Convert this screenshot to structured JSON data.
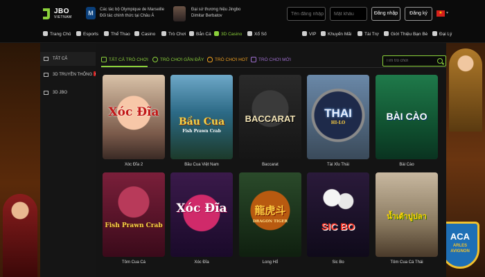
{
  "header": {
    "logo_text": "JBO",
    "logo_sub": "VIETNAM",
    "partner_line1": "Các tác bộ Olympique de Marseille",
    "partner_line2": "Đối tác chính thức tại Châu Á",
    "ambassador_line1": "Đại sứ thương hiệu Jingbo",
    "ambassador_line2": "Dimitar Berbatov",
    "username_placeholder": "Tên đăng nhập",
    "password_placeholder": "Mật khẩu",
    "login_label": "Đăng nhập",
    "register_label": "Đăng ký",
    "flag_star": "★",
    "caret": "▾"
  },
  "nav": {
    "items": [
      "Trang Chủ",
      "Esports",
      "Thể Thao",
      "Casino",
      "Trò Chơi",
      "Bắn Cá",
      "3D Casino",
      "Xổ Số"
    ],
    "right_items": [
      "VIP",
      "Khuyến Mãi",
      "Tài Trợ",
      "Giới Thiệu Bạn Bè",
      "Đại Lý"
    ]
  },
  "sidebar": {
    "items": [
      {
        "label": "TẤT CẢ"
      },
      {
        "label": "3D TRUYỀN THỐNG",
        "badge": "HOT"
      },
      {
        "label": "3D JBO"
      }
    ]
  },
  "tabs": {
    "all": "TẤT CẢ TRÒ CHƠI",
    "recent": "TRÒ CHƠI GẦN ĐÂY",
    "hot": "TRÒ CHƠI HOT",
    "new": "TRÒ CHƠI MỚI"
  },
  "search": {
    "placeholder": "Tìm trò chơi"
  },
  "games": [
    {
      "name": "Xóc Đĩa 2",
      "art_title": "Xóc Đĩa"
    },
    {
      "name": "Bầu Cua Việt Nam",
      "art_title": "Bầu Cua",
      "art_sub": "Fish Prawn Crab"
    },
    {
      "name": "Baccarat",
      "art_title": "BACCARAT"
    },
    {
      "name": "Tài Xỉu Thái",
      "art_title": "THAI",
      "art_sub": "HI-LO"
    },
    {
      "name": "Bài Cào",
      "art_title": "BÀI CÀO"
    },
    {
      "name": "Tôm Cua Cá",
      "art_title": "Fish Prawn Crab"
    },
    {
      "name": "Xóc Đĩa",
      "art_title": "Xóc Đĩa"
    },
    {
      "name": "Long Hổ",
      "art_title": "龍虎斗",
      "art_sub": "DRAGON TIGER"
    },
    {
      "name": "Sic Bo",
      "art_title": "SIC BO"
    },
    {
      "name": "Tôm Cua Cá Thái",
      "art_title": "น้ำเต้าปูปลา"
    }
  ],
  "aca_badge": {
    "title": "ACA",
    "line1": "ARLES",
    "line2": "AVIGNON"
  },
  "colors": {
    "accent": "#8bd13b",
    "hot": "#f0a020",
    "new": "#a070d0",
    "badge": "#d61f1f"
  }
}
